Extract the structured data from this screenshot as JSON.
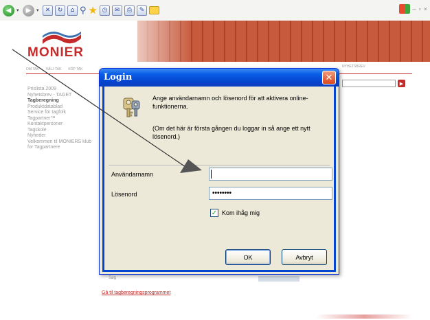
{
  "dialog": {
    "title": "Login",
    "message_line1": "Ange användarnamn och lösenord för att aktivera online-funktionerna.",
    "message_line2": "(Om det här är första gången du loggar in så ange ett nytt lösenord.)",
    "username_label": "Användarnamn",
    "username_value": "",
    "password_label": "Lösenord",
    "password_value": "••••••••",
    "remember_label": "Kom ihåg mig",
    "remember_checked": true,
    "ok_label": "OK",
    "cancel_label": "Avbryt",
    "close_glyph": "✕"
  },
  "page": {
    "logo_text": "MONIER",
    "nav_items": [
      "OM TAK",
      "VÅLJ TAK",
      "KÖP TAK"
    ],
    "nav_right": "NYHETSBREV",
    "side_menu": [
      "Prislista 2009",
      "Nyhetsbrev - TAGET",
      "Tagberegning",
      "Produktdatablad",
      "Service för tagfolk",
      "Tagpartner™",
      "Kontaktpersoner",
      "Tagskole",
      "Nyheder",
      "Velkommen til MONIERS klub for Tagpartnere"
    ],
    "bold_menu_item": "Tagberegning",
    "small_text": "Søg",
    "link_text": "Gå til tagberegningsprogrammet"
  },
  "colors": {
    "brand_red": "#c42a2a",
    "xp_title_blue": "#0546cf",
    "dialog_bg": "#ece9d8"
  },
  "icons": [
    "back-icon",
    "forward-icon",
    "stop-icon",
    "refresh-icon",
    "home-icon",
    "search-icon",
    "favorites-icon",
    "history-icon",
    "mail-icon",
    "print-icon",
    "edit-icon",
    "folder-icon",
    "keys-icon"
  ]
}
